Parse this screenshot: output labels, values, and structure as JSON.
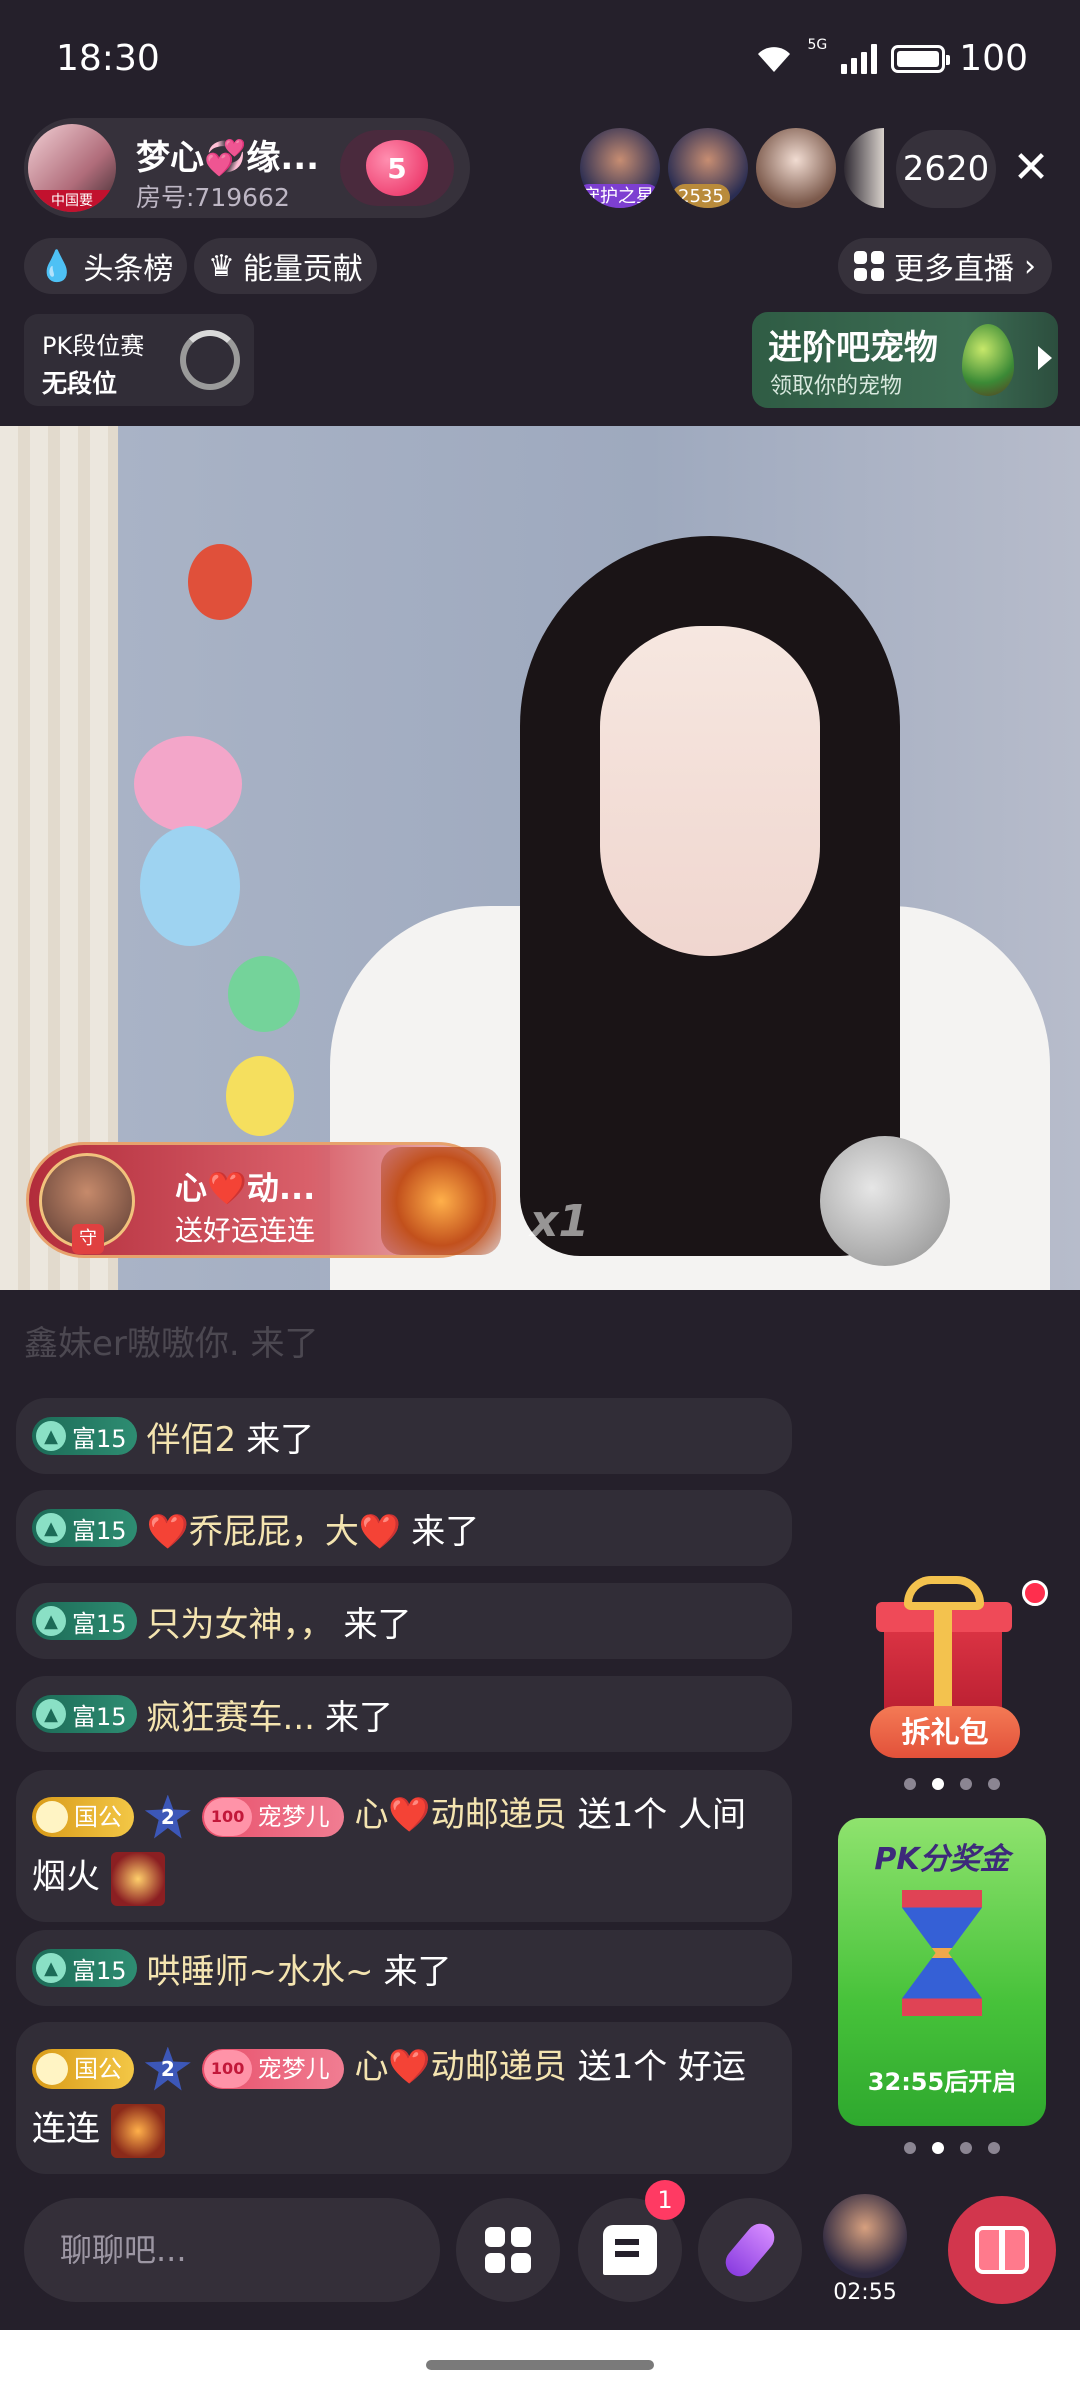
{
  "status_bar": {
    "time": "18:30",
    "network": "5G",
    "battery": "100"
  },
  "host": {
    "name": "梦心💞缘...",
    "room_no": "房号:719662",
    "avatar_tag": "中国要",
    "heart_level": "5"
  },
  "viewers": [
    {
      "badge": "守护之星"
    },
    {
      "badge": "2535"
    },
    {
      "badge": ""
    },
    {
      "badge": ""
    }
  ],
  "viewer_count": "2620",
  "chips": {
    "headline": "头条榜",
    "energy": "能量贡献",
    "more_live": "更多直播"
  },
  "pk_rank": {
    "title": "PK段位赛",
    "rank": "无段位"
  },
  "pet_banner": {
    "title": "进阶吧宠物",
    "subtitle": "领取你的宠物"
  },
  "gift_banner": {
    "sender": "心❤️动...",
    "action": "送好运连连",
    "avatar_tag": "守",
    "count": "x1"
  },
  "chat": {
    "faded": "鑫妹er嗷嗷你. 来了",
    "messages": [
      {
        "level": "富15",
        "name": "伴佰2",
        "text": "来了"
      },
      {
        "level": "富15",
        "name": "❤️乔屁屁，大❤️",
        "text": "来了"
      },
      {
        "level": "富15",
        "name": "只为女神，，",
        "text": "来了"
      },
      {
        "level": "富15",
        "name": "疯狂赛车...",
        "text": "来了"
      },
      {
        "level": "富15",
        "name": "哄睡师~水水~",
        "text": "来了"
      }
    ],
    "gifts": [
      {
        "gov": "国公",
        "star": "2",
        "fan_level": "100",
        "fan_name": "宠梦儿",
        "sender": "心❤️动邮递员",
        "action": "送1个",
        "gift": "人间烟火"
      },
      {
        "gov": "国公",
        "star": "2",
        "fan_level": "100",
        "fan_name": "宠梦儿",
        "sender": "心❤️动邮递员",
        "action": "送1个",
        "gift": "好运连连"
      }
    ]
  },
  "gift_box": {
    "label": "拆礼包"
  },
  "pk_card": {
    "title": "PK分奖金",
    "countdown": "32:55后开启"
  },
  "bottom": {
    "input_placeholder": "聊聊吧...",
    "message_badge": "1",
    "anchor_timer": "02:55"
  },
  "colors": {
    "background": "#25202b",
    "accent_red": "#d2364d",
    "level_green": "#2e8d72",
    "name_gold": "#f4e4b0"
  }
}
